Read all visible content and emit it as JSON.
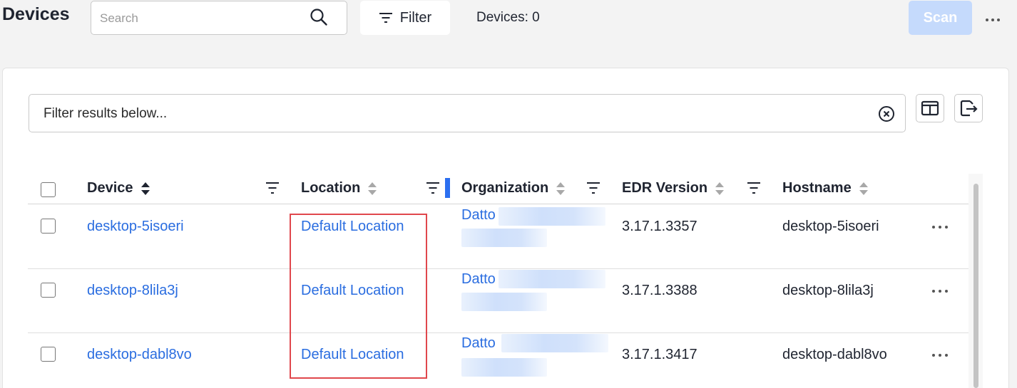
{
  "header": {
    "title": "Devices",
    "search_placeholder": "Search",
    "filter_label": "Filter",
    "device_count": "Devices: 0",
    "scan_label": "Scan",
    "more_icon": "more-horizontal-icon"
  },
  "toolbar": {
    "filter_placeholder": "Filter results below..."
  },
  "table": {
    "columns": [
      "Device",
      "Location",
      "Organization",
      "EDR Version",
      "Hostname"
    ],
    "rows": [
      {
        "device": "desktop-5isoeri",
        "location": "Default Location",
        "organization": "Datto",
        "edr_version": "3.17.1.3357",
        "hostname": "desktop-5isoeri"
      },
      {
        "device": "desktop-8lila3j",
        "location": "Default Location",
        "organization": "Datto",
        "edr_version": "3.17.1.3388",
        "hostname": "desktop-8lila3j"
      },
      {
        "device": "desktop-dabl8vo",
        "location": "Default Location",
        "organization": "Datto",
        "edr_version": "3.17.1.3417",
        "hostname": "desktop-dabl8vo"
      }
    ]
  },
  "colors": {
    "link": "#2a6de0",
    "scan_disabled": "#c5dafc",
    "highlight": "#e0474c",
    "resize_bar": "#2c6ff0"
  }
}
